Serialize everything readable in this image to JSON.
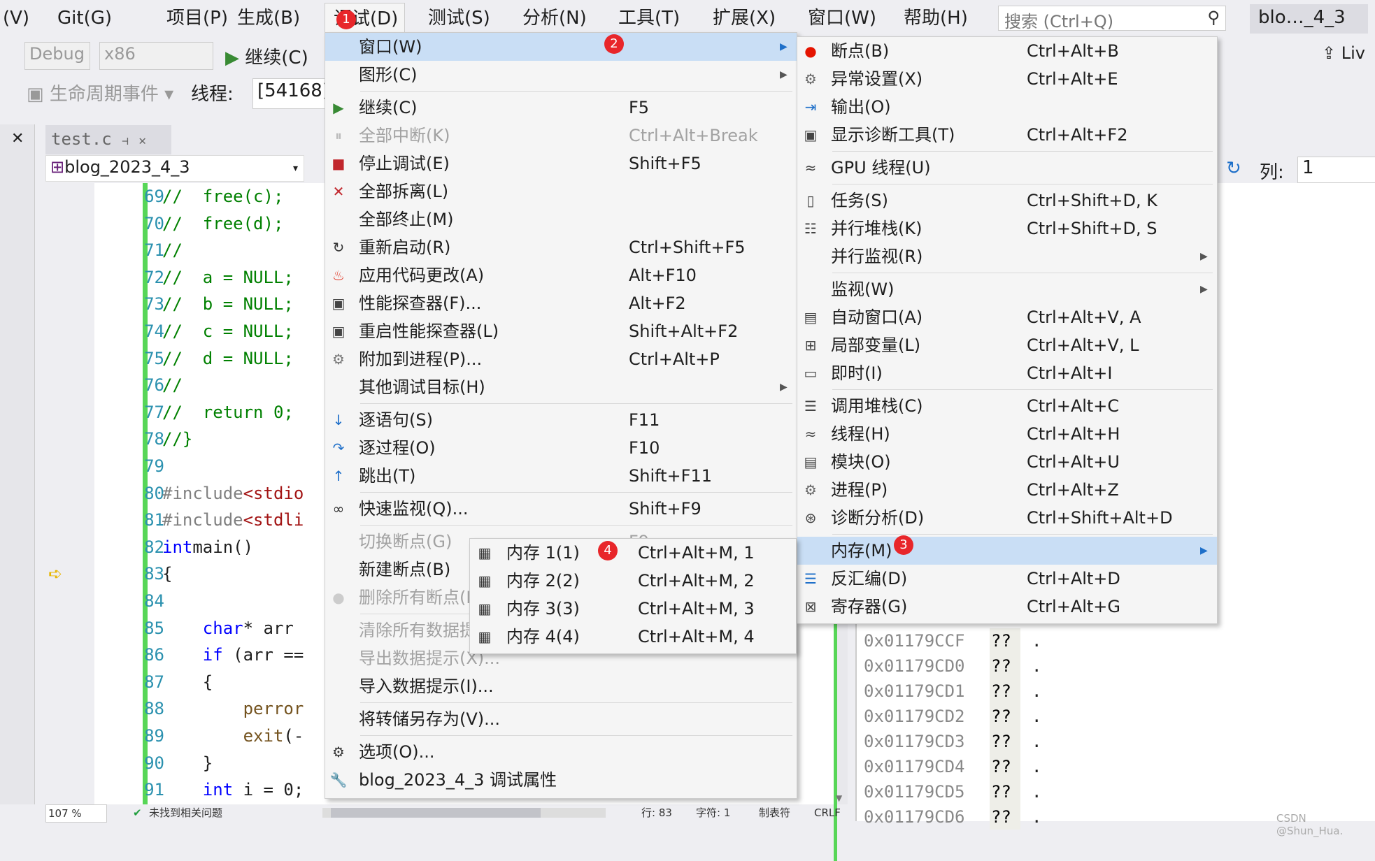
{
  "menubar": {
    "items": [
      "(V)",
      "Git(G)",
      "项目(P)",
      "生成(B)",
      "调试(D)",
      "测试(S)",
      "分析(N)",
      "工具(T)",
      "扩展(X)",
      "窗口(W)",
      "帮助(H)"
    ],
    "active": "调试(D)",
    "search_placeholder": "搜索 (Ctrl+Q)",
    "solution_title": "blo…_4_3"
  },
  "toolbar": {
    "config": "Debug",
    "platform": "x86",
    "continue": "继续(C)",
    "live_share": "Liv",
    "lifecycle": "生命周期事件",
    "thread_label": "线程:",
    "thread_value": "[54168]"
  },
  "editor": {
    "tab": "test.c",
    "scope": "blog_2023_4_3",
    "current_line": 83,
    "lines": [
      {
        "n": "69",
        "t": [
          [
            "cmt",
            "//  free(c);"
          ]
        ]
      },
      {
        "n": "70",
        "t": [
          [
            "cmt",
            "//  free(d);"
          ]
        ]
      },
      {
        "n": "71",
        "t": [
          [
            "cmt",
            "//"
          ]
        ]
      },
      {
        "n": "72",
        "t": [
          [
            "cmt",
            "//  a = NULL;"
          ]
        ]
      },
      {
        "n": "73",
        "t": [
          [
            "cmt",
            "//  b = NULL;"
          ]
        ]
      },
      {
        "n": "74",
        "t": [
          [
            "cmt",
            "//  c = NULL;"
          ]
        ]
      },
      {
        "n": "75",
        "t": [
          [
            "cmt",
            "//  d = NULL;"
          ]
        ]
      },
      {
        "n": "76",
        "t": [
          [
            "cmt",
            "//"
          ]
        ]
      },
      {
        "n": "77",
        "t": [
          [
            "cmt",
            "//  return 0;"
          ]
        ]
      },
      {
        "n": "78",
        "t": [
          [
            "cmt",
            "//}"
          ]
        ]
      },
      {
        "n": "79",
        "t": []
      },
      {
        "n": "80",
        "t": [
          [
            "pp",
            "#include"
          ],
          [
            "str",
            "<stdio"
          ]
        ]
      },
      {
        "n": "81",
        "t": [
          [
            "pp",
            "#include"
          ],
          [
            "str",
            "<stdli"
          ]
        ]
      },
      {
        "n": "82",
        "t": [
          [
            "kw",
            "int"
          ],
          [
            "",
            "main()"
          ]
        ]
      },
      {
        "n": "83",
        "t": [
          [
            "",
            "{"
          ]
        ]
      },
      {
        "n": "84",
        "t": []
      },
      {
        "n": "85",
        "t": [
          [
            "",
            "    "
          ],
          [
            "kw",
            "char"
          ],
          [
            "",
            "* arr"
          ]
        ]
      },
      {
        "n": "86",
        "t": [
          [
            "",
            "    "
          ],
          [
            "kw",
            "if"
          ],
          [
            "",
            " (arr =="
          ]
        ]
      },
      {
        "n": "87",
        "t": [
          [
            "",
            "    {"
          ]
        ]
      },
      {
        "n": "88",
        "t": [
          [
            "",
            "        "
          ],
          [
            "fn",
            "perror"
          ]
        ]
      },
      {
        "n": "89",
        "t": [
          [
            "",
            "        "
          ],
          [
            "fn",
            "exit"
          ],
          [
            "",
            "(-"
          ]
        ]
      },
      {
        "n": "90",
        "t": [
          [
            "",
            "    }"
          ]
        ]
      },
      {
        "n": "91",
        "t": [
          [
            "",
            "    "
          ],
          [
            "kw",
            "int"
          ],
          [
            "",
            " i = 0;"
          ]
        ]
      }
    ]
  },
  "column": {
    "label": "列:",
    "value": "1"
  },
  "memory": {
    "rows": [
      {
        "addr": "0x01179CCF",
        "val": "??",
        "ch": "."
      },
      {
        "addr": "0x01179CD0",
        "val": "??",
        "ch": "."
      },
      {
        "addr": "0x01179CD1",
        "val": "??",
        "ch": "."
      },
      {
        "addr": "0x01179CD2",
        "val": "??",
        "ch": "."
      },
      {
        "addr": "0x01179CD3",
        "val": "??",
        "ch": "."
      },
      {
        "addr": "0x01179CD4",
        "val": "??",
        "ch": "."
      },
      {
        "addr": "0x01179CD5",
        "val": "??",
        "ch": "."
      },
      {
        "addr": "0x01179CD6",
        "val": "??",
        "ch": "."
      }
    ]
  },
  "debug_menu": [
    {
      "label": "窗口(W)",
      "hl": true,
      "sub": true
    },
    {
      "label": "图形(C)",
      "sub": true
    },
    {
      "sep": true
    },
    {
      "label": "继续(C)",
      "sc": "F5",
      "icon": "play-icon",
      "g": "▶",
      "c": "#388a34"
    },
    {
      "label": "全部中断(K)",
      "sc": "Ctrl+Alt+Break",
      "dis": true,
      "icon": "pause-icon",
      "g": "⏸",
      "c": "#bbb"
    },
    {
      "label": "停止调试(E)",
      "sc": "Shift+F5",
      "icon": "stop-icon",
      "g": "■",
      "c": "#c1272d"
    },
    {
      "label": "全部拆离(L)",
      "icon": "detach-icon",
      "g": "✕",
      "c": "#c1272d"
    },
    {
      "label": "全部终止(M)"
    },
    {
      "label": "重新启动(R)",
      "sc": "Ctrl+Shift+F5",
      "icon": "restart-icon",
      "g": "↻",
      "c": "#333"
    },
    {
      "label": "应用代码更改(A)",
      "sc": "Alt+F10",
      "icon": "hot-reload-icon",
      "g": "♨",
      "c": "#e0301e"
    },
    {
      "label": "性能探查器(F)...",
      "sc": "Alt+F2",
      "icon": "profiler-icon",
      "g": "▣",
      "c": "#444"
    },
    {
      "label": "重启性能探查器(L)",
      "sc": "Shift+Alt+F2",
      "icon": "profiler-restart-icon",
      "g": "▣",
      "c": "#444"
    },
    {
      "label": "附加到进程(P)...",
      "sc": "Ctrl+Alt+P",
      "icon": "attach-icon",
      "g": "⚙",
      "c": "#777"
    },
    {
      "label": "其他调试目标(H)",
      "sub": true
    },
    {
      "sep": true
    },
    {
      "label": "逐语句(S)",
      "sc": "F11",
      "icon": "step-into-icon",
      "g": "↓",
      "c": "#1e6fc9"
    },
    {
      "label": "逐过程(O)",
      "sc": "F10",
      "icon": "step-over-icon",
      "g": "↷",
      "c": "#1e6fc9"
    },
    {
      "label": "跳出(T)",
      "sc": "Shift+F11",
      "icon": "step-out-icon",
      "g": "↑",
      "c": "#1e6fc9"
    },
    {
      "sep": true
    },
    {
      "label": "快速监视(Q)...",
      "sc": "Shift+F9",
      "icon": "glasses-icon",
      "g": "∞",
      "c": "#333"
    },
    {
      "sep": true
    },
    {
      "label": "切换断点(G)",
      "sc": "F9",
      "dis": true
    },
    {
      "label": "新建断点(B)",
      "sub": true
    },
    {
      "label": "删除所有断点(D)",
      "dis": true,
      "icon": "delete-breakpoints-icon",
      "g": "●",
      "c": "#ccc"
    },
    {
      "sep": true
    },
    {
      "label": "清除所有数据提示(A)",
      "dis": true
    },
    {
      "label": "导出数据提示(X)...",
      "dis": true
    },
    {
      "label": "导入数据提示(I)..."
    },
    {
      "sep": true
    },
    {
      "label": "将转储另存为(V)..."
    },
    {
      "sep": true
    },
    {
      "label": "选项(O)...",
      "icon": "gear-icon",
      "g": "⚙",
      "c": "#333"
    },
    {
      "label": "blog_2023_4_3 调试属性",
      "icon": "wrench-icon",
      "g": "🔧",
      "c": "#333"
    }
  ],
  "window_menu": [
    {
      "label": "断点(B)",
      "sc": "Ctrl+Alt+B",
      "icon": "breakpoint-icon",
      "g": "●",
      "c": "#e51400"
    },
    {
      "label": "异常设置(X)",
      "sc": "Ctrl+Alt+E",
      "icon": "exception-settings-icon",
      "g": "⚙",
      "c": "#666"
    },
    {
      "label": "输出(O)",
      "icon": "output-icon",
      "g": "⇥",
      "c": "#1e6fc9"
    },
    {
      "label": "显示诊断工具(T)",
      "sc": "Ctrl+Alt+F2",
      "icon": "diagnostics-icon",
      "g": "▣",
      "c": "#444"
    },
    {
      "sep": true
    },
    {
      "label": "GPU 线程(U)",
      "icon": "gpu-threads-icon",
      "g": "≈",
      "c": "#444"
    },
    {
      "sep": true
    },
    {
      "label": "任务(S)",
      "sc": "Ctrl+Shift+D, K",
      "icon": "tasks-icon",
      "g": "▯",
      "c": "#444"
    },
    {
      "label": "并行堆栈(K)",
      "sc": "Ctrl+Shift+D, S",
      "icon": "parallel-stacks-icon",
      "g": "☷",
      "c": "#444"
    },
    {
      "label": "并行监视(R)",
      "sub": true
    },
    {
      "sep": true
    },
    {
      "label": "监视(W)",
      "sub": true
    },
    {
      "label": "自动窗口(A)",
      "sc": "Ctrl+Alt+V, A",
      "icon": "autos-icon",
      "g": "▤",
      "c": "#444"
    },
    {
      "label": "局部变量(L)",
      "sc": "Ctrl+Alt+V, L",
      "icon": "locals-icon",
      "g": "⊞",
      "c": "#444"
    },
    {
      "label": "即时(I)",
      "sc": "Ctrl+Alt+I",
      "icon": "immediate-icon",
      "g": "▭",
      "c": "#444"
    },
    {
      "sep": true
    },
    {
      "label": "调用堆栈(C)",
      "sc": "Ctrl+Alt+C",
      "icon": "call-stack-icon",
      "g": "☰",
      "c": "#444"
    },
    {
      "label": "线程(H)",
      "sc": "Ctrl+Alt+H",
      "icon": "threads-icon",
      "g": "≈",
      "c": "#444"
    },
    {
      "label": "模块(O)",
      "sc": "Ctrl+Alt+U",
      "icon": "modules-icon",
      "g": "▤",
      "c": "#444"
    },
    {
      "label": "进程(P)",
      "sc": "Ctrl+Alt+Z",
      "icon": "processes-icon",
      "g": "⚙",
      "c": "#666"
    },
    {
      "label": "诊断分析(D)",
      "sc": "Ctrl+Shift+Alt+D",
      "icon": "diagnostic-analysis-icon",
      "g": "⊛",
      "c": "#444"
    },
    {
      "sep": true
    },
    {
      "label": "内存(M)",
      "hl": true,
      "sub": true
    },
    {
      "label": "反汇编(D)",
      "sc": "Ctrl+Alt+D",
      "icon": "disassembly-icon",
      "g": "☰",
      "c": "#1e6fc9"
    },
    {
      "label": "寄存器(G)",
      "sc": "Ctrl+Alt+G",
      "icon": "registers-icon",
      "g": "⊠",
      "c": "#444"
    }
  ],
  "memory_menu": [
    {
      "label": "内存 1(1)",
      "sc": "Ctrl+Alt+M, 1",
      "icon": "memory-chip-icon",
      "g": "▦",
      "c": "#333"
    },
    {
      "label": "内存 2(2)",
      "sc": "Ctrl+Alt+M, 2",
      "icon": "memory-chip-icon",
      "g": "▦",
      "c": "#333"
    },
    {
      "label": "内存 3(3)",
      "sc": "Ctrl+Alt+M, 3",
      "icon": "memory-chip-icon",
      "g": "▦",
      "c": "#333"
    },
    {
      "label": "内存 4(4)",
      "sc": "Ctrl+Alt+M, 4",
      "icon": "memory-chip-icon",
      "g": "▦",
      "c": "#333"
    }
  ],
  "badges": [
    "1",
    "2",
    "3",
    "4"
  ],
  "badge_color": "#e8262a",
  "statusbar": {
    "zoom": "107 %",
    "issues": "未找到相关问题",
    "line": "行: 83",
    "char": "字符: 1",
    "tabs": "制表符",
    "eol": "CRLF"
  },
  "watermark": "CSDN @Shun_Hua."
}
